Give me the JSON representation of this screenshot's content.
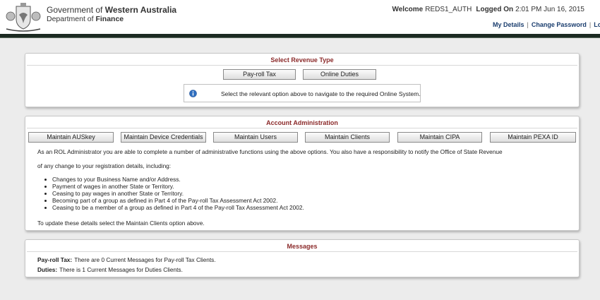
{
  "header": {
    "org_prefix": "Government of",
    "org_name": "Western Australia",
    "dept_prefix": "Department of",
    "dept_name": "Finance",
    "welcome_label": "Welcome",
    "username": "REDS1_AUTH",
    "logged_on_label": "Logged On",
    "logged_on_time": "2:01 PM Jun 16, 2015",
    "links": {
      "my_details": "My Details",
      "change_password": "Change Password",
      "logout": "Logout",
      "separator": "|"
    }
  },
  "revenue": {
    "title": "Select Revenue Type",
    "buttons": [
      "Pay-roll Tax",
      "Online Duties"
    ],
    "info_text": "Select the relevant option above to navigate to the required Online System."
  },
  "account_admin": {
    "title": "Account Administration",
    "buttons": [
      "Maintain AUSkey",
      "Maintain Device Credentials",
      "Maintain Users",
      "Maintain Clients",
      "Maintain CIPA",
      "Maintain PEXA ID"
    ],
    "intro_1": "As an ROL Administrator you are able to complete a number of administrative functions using the above options. You also have a responsibility to notify the Office of State Revenue",
    "intro_2": "of any change to your registration details, including:",
    "bullets": [
      "Changes to your Business Name and/or Address.",
      "Payment of wages in another State or Territory.",
      "Ceasing to pay wages in another State or Territory.",
      "Becoming part of a group as defined in Part 4 of the Pay-roll Tax Assessment Act 2002.",
      "Ceasing to be a member of a group as defined in Part 4 of the Pay-roll Tax Assessment Act 2002."
    ],
    "footer": "To update these details select the Maintain Clients option above."
  },
  "messages": {
    "title": "Messages",
    "items": [
      {
        "label": "Pay-roll Tax:",
        "text": "There are 0 Current Messages for Pay-roll Tax Clients."
      },
      {
        "label": "Duties:",
        "text": "There is 1 Current Messages for Duties Clients."
      }
    ]
  },
  "colors": {
    "panel_title": "#8b2a2a",
    "header_band": "#1c2a22",
    "link": "#1a3d6e",
    "info_icon": "#2f6fc0"
  },
  "icons": {
    "crest": "wa-government-crest",
    "info": "info-icon"
  }
}
